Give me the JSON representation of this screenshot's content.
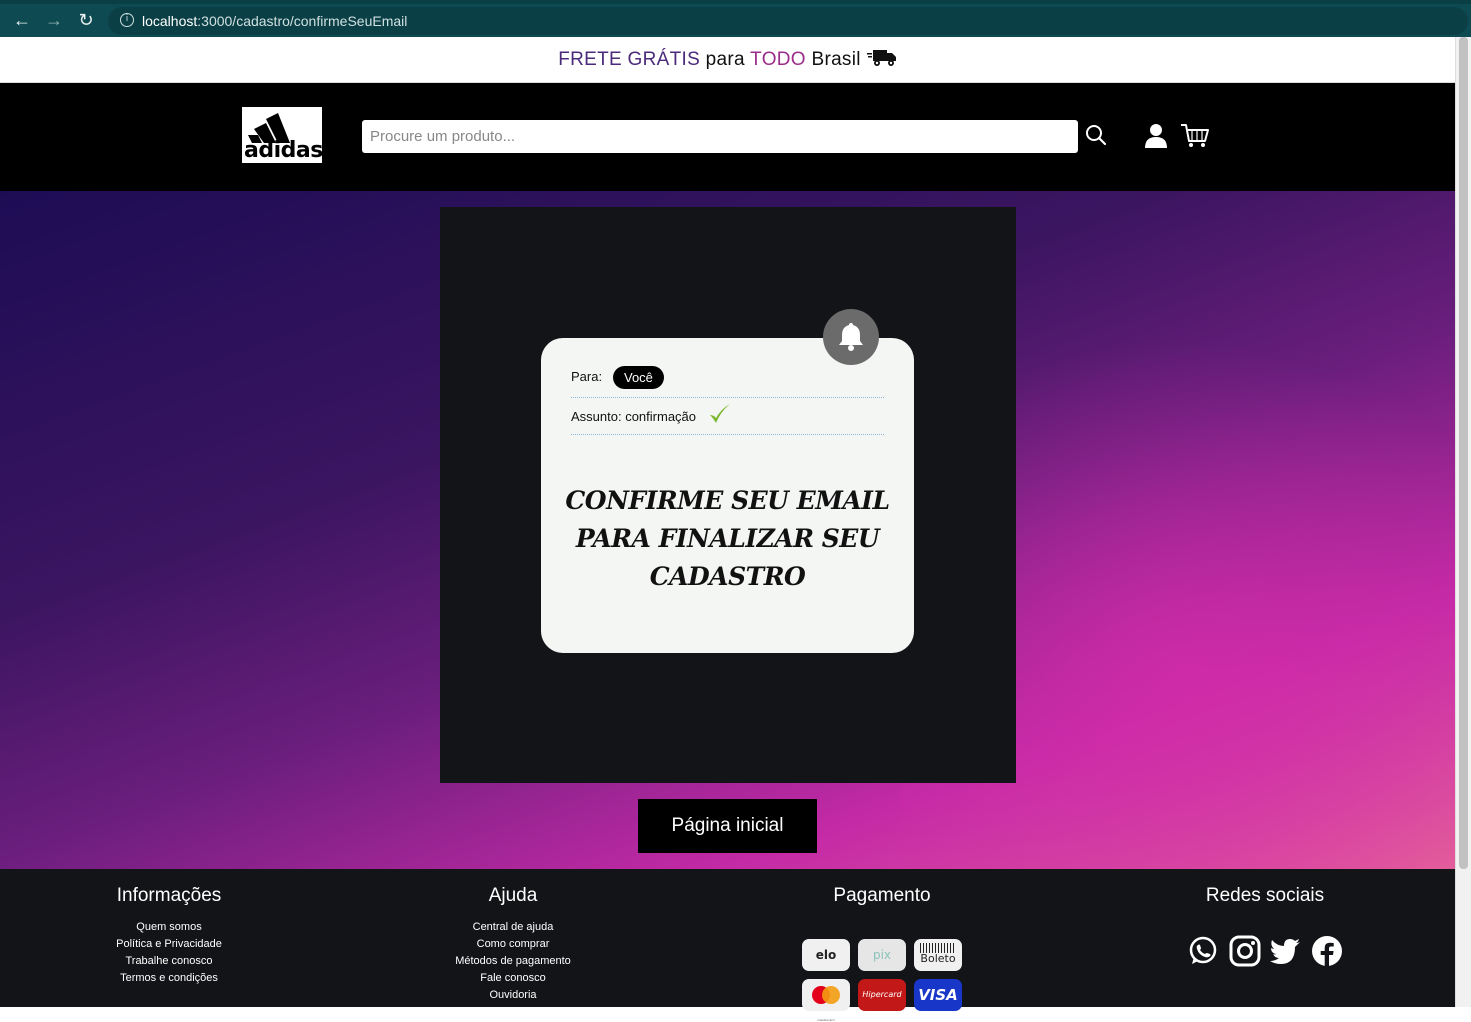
{
  "browser": {
    "url_host": "localhost",
    "url_path": ":3000/cadastro/confirmeSeuEmail"
  },
  "promo": {
    "part1": "FRETE GRÁTIS",
    "part2": " para ",
    "part3": "TODO",
    "part4": " Brasil"
  },
  "header": {
    "logo_text": "adidas",
    "search_placeholder": "Procure um produto..."
  },
  "email_card": {
    "to_label": "Para:",
    "to_value": "Você",
    "subject_label": "Assunto: confirmação",
    "message": "CONFIRME SEU EMAIL PARA FINALIZAR SEU CADASTRO"
  },
  "home_button_label": "Página inicial",
  "footer": {
    "info": {
      "heading": "Informações",
      "links": [
        "Quem somos",
        "Política e Privacidade",
        "Trabalhe conosco",
        "Termos e condições"
      ]
    },
    "help": {
      "heading": "Ajuda",
      "links": [
        "Central de ajuda",
        "Como comprar",
        "Métodos de pagamento",
        "Fale conosco",
        "Ouvidoria"
      ]
    },
    "payment": {
      "heading": "Pagamento",
      "methods": [
        "elo",
        "pix",
        "Boleto",
        "mastercard",
        "Hipercard",
        "VISA"
      ]
    },
    "social": {
      "heading": "Redes sociais",
      "networks": [
        "whatsapp",
        "instagram",
        "twitter",
        "facebook"
      ]
    }
  },
  "colors": {
    "promo_purple": "#4b2a7b",
    "promo_magenta": "#9b2d8a",
    "panel_dark": "#121417",
    "card_bg": "#f4f6f3"
  }
}
